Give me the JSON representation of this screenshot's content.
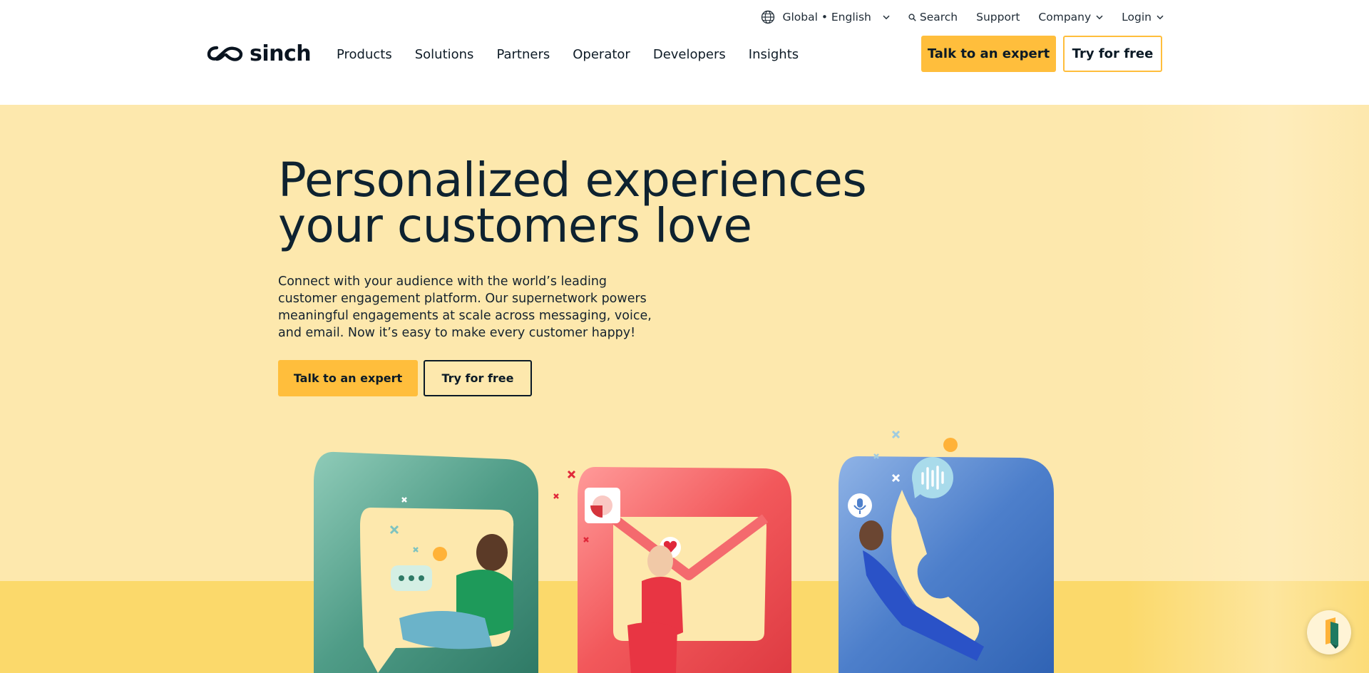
{
  "brand": {
    "name": "sinch",
    "accent": "#ffbe3c",
    "text": "#0c2132",
    "hero_bg": "#fde8ad"
  },
  "utility_nav": {
    "region": "Global • English",
    "search": "Search",
    "support": "Support",
    "company": "Company",
    "login": "Login"
  },
  "main_nav": {
    "items": [
      "Products",
      "Solutions",
      "Partners",
      "Operator",
      "Developers",
      "Insights"
    ]
  },
  "header_cta": {
    "primary": "Talk to an expert",
    "secondary": "Try for free"
  },
  "hero": {
    "headline": "Personalized experiences your customers love",
    "body": "Connect with your audience with the world’s leading customer engagement platform. Our supernetwork powers meaningful engagements at scale across messaging, voice, and email. Now it’s easy to make every customer happy!",
    "cta_primary": "Talk to an expert",
    "cta_secondary": "Try for free"
  },
  "illustrations": {
    "cards": [
      "messaging-card",
      "email-card",
      "voice-card"
    ],
    "icons": [
      "chat-bubble-icon",
      "heart-icon",
      "microphone-icon",
      "sound-wave-icon"
    ]
  },
  "chat_widget": {
    "icon": "chat-widget-icon"
  }
}
